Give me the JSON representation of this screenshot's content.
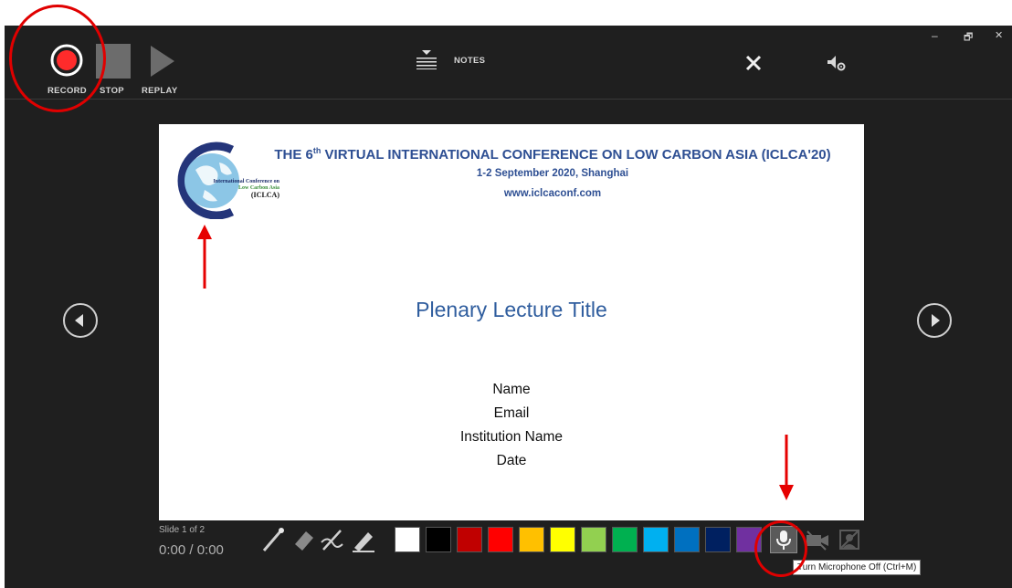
{
  "toolbar": {
    "record_label": "RECORD",
    "stop_label": "STOP",
    "replay_label": "REPLAY",
    "notes_label": "NOTES"
  },
  "window_controls": {
    "minimize": "–",
    "restore": "🗗",
    "close": "✕"
  },
  "slide": {
    "header": {
      "title_pre": "THE 6",
      "title_sup": "th",
      "title_post": " VIRTUAL INTERNATIONAL CONFERENCE ON LOW CARBON ASIA (ICLCA'20)",
      "date_location": "1-2 September 2020, Shanghai",
      "website": "www.iclcaconf.com"
    },
    "logo": {
      "line1": "International Conference on",
      "line2": "Low Carbon Asia",
      "line3": "(ICLCA)"
    },
    "lecture_title": "Plenary Lecture Title",
    "details": [
      "Name",
      "Email",
      "Institution Name",
      "Date"
    ]
  },
  "status": {
    "slide_counter": "Slide 1 of 2",
    "timer": "0:00 / 0:00"
  },
  "pen_colors": [
    "#ffffff",
    "#000000",
    "#c00000",
    "#ff0000",
    "#ffc000",
    "#ffff00",
    "#92d050",
    "#00b050",
    "#00b0f0",
    "#0070c0",
    "#002060",
    "#7030a0"
  ],
  "tooltip": "Turn Microphone Off (Ctrl+M)",
  "annotation_color": "#e00000"
}
